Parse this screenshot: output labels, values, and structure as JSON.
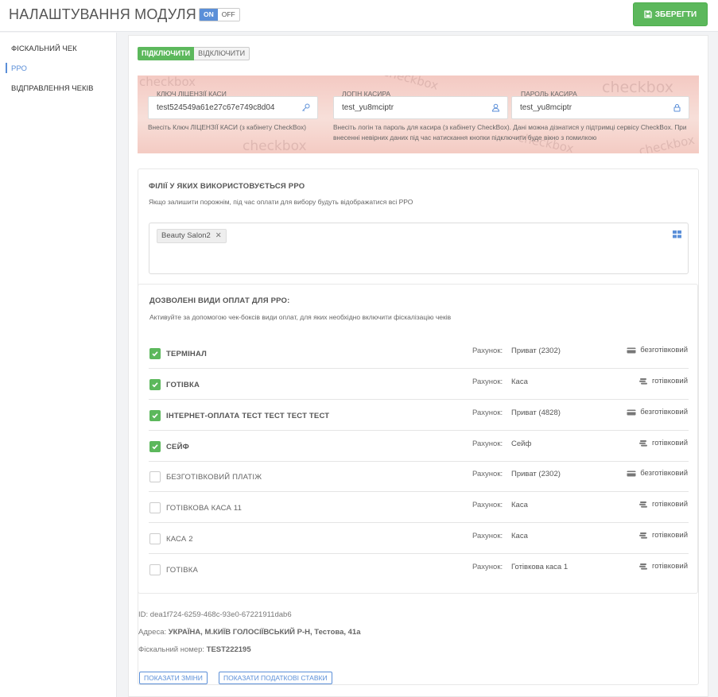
{
  "header": {
    "title": "НАЛАШТУВАННЯ МОДУЛЯ",
    "toggle_on": "ON",
    "toggle_off": "OFF",
    "save_label": "ЗБЕРЕГТИ"
  },
  "sidebar": {
    "items": [
      {
        "label": "ФІСКАЛЬНИЙ ЧЕК"
      },
      {
        "label": "РРО"
      },
      {
        "label": "ВІДПРАВЛЕННЯ ЧЕКІВ"
      }
    ]
  },
  "connection": {
    "connect_label": "ПІДКЛЮЧИТИ",
    "disconnect_label": "ВІДКЛЮЧИТИ"
  },
  "credentials": {
    "watermark": "checkbox",
    "license_key": {
      "label": "КЛЮЧ ЛІЦЕНЗІЇ КАСИ",
      "value": "test524549a61e27c67e749c8d04",
      "help": "Внесіть Ключ ЛІЦЕНЗІЇ КАСИ (з кабінету CheckBox)"
    },
    "login": {
      "label": "ЛОГІН КАСИРА",
      "value": "test_yu8mciptr"
    },
    "password": {
      "label": "ПАРОЛЬ КАСИРА",
      "value": "test_yu8mciptr"
    },
    "login_help": "Внесіть логін та пароль для касира (з кабінету CheckBox). Дані можна дізнатися у підтримці сервісу CheckBox. При внесенні невірних даних під час натискання кнопки підключити буде вікно з помилкою"
  },
  "branches": {
    "title": "ФІЛІЇ У ЯКИХ ВИКОРИСТОВУЄТЬСЯ РРО",
    "subtitle": "Якщо залишити порожнім, під час оплати для вибору будуть відображатися всі РРО",
    "selected": [
      "Beauty Salon2"
    ]
  },
  "payments": {
    "title": "ДОЗВОЛЕНІ ВИДИ ОПЛАТ ДЛЯ РРО:",
    "subtitle": "Активуйте за допомогою чек-боксів види оплат, для яких необхідно включити фіскалізацію чеків",
    "account_label": "Рахунок:",
    "rows": [
      {
        "name": "ТЕРМІНАЛ",
        "checked": true,
        "account": "Приват (2302)",
        "type": "безготівковий",
        "icon": "card-icon"
      },
      {
        "name": "ГОТІВКА",
        "checked": true,
        "account": "Каса",
        "type": "готівковий",
        "icon": "coins-icon"
      },
      {
        "name": "ІНТЕРНЕТ-ОПЛАТА ТЕСТ ТЕСТ ТЕСТ ТЕСТ",
        "checked": true,
        "account": "Приват (4828)",
        "type": "безготівковий",
        "icon": "card-icon"
      },
      {
        "name": "СЕЙФ",
        "checked": true,
        "account": "Сейф",
        "type": "готівковий",
        "icon": "coins-icon"
      },
      {
        "name": "БЕЗГОТІВКОВИЙ ПЛАТІЖ",
        "checked": false,
        "account": "Приват (2302)",
        "type": "безготівковий",
        "icon": "card-icon"
      },
      {
        "name": "ГОТІВКОВА КАСА 11",
        "checked": false,
        "account": "Каса",
        "type": "готівковий",
        "icon": "coins-icon"
      },
      {
        "name": "КАСА 2",
        "checked": false,
        "account": "Каса",
        "type": "готівковий",
        "icon": "coins-icon"
      },
      {
        "name": "ГОТІВКА",
        "checked": false,
        "account": "Готівкова каса 1",
        "type": "готівковий",
        "icon": "coins-icon"
      }
    ]
  },
  "info": {
    "id_label": "ID:",
    "id_value": "dea1f724-6259-468c-93e0-67221911dab6",
    "address_label": "Адреса:",
    "address_value": "УКРАЇНА, М.КИЇВ ГОЛОСІЇВСЬКИЙ Р-Н, Тестова, 41а",
    "fiscal_label": "Фіскальний номер:",
    "fiscal_value": "TEST222195"
  },
  "actions": {
    "show_changes": "ПОКАЗАТИ ЗМІНИ",
    "show_tax_rates": "ПОКАЗАТИ ПОДАТКОВІ СТАВКИ"
  },
  "colors": {
    "accent": "#5b8fd8",
    "success": "#5cb85c",
    "credentials_bg": "#f4c9c2"
  }
}
